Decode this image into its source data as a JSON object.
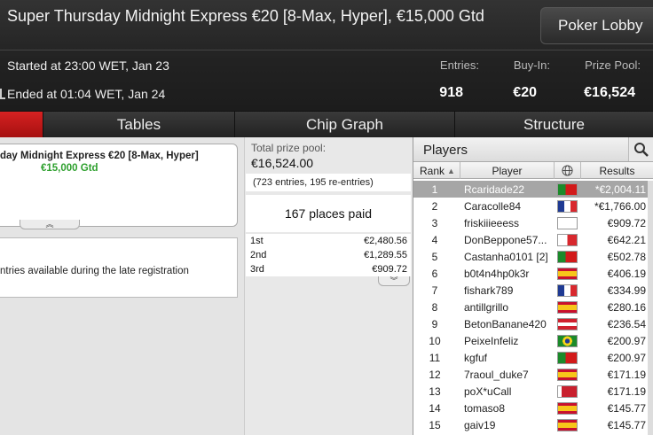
{
  "header": {
    "title": "Super Thursday Midnight Express €20 [8-Max, Hyper], €15,000 Gtd",
    "lobby_button": "Poker Lobby",
    "started": "Started at 23:00 WET, Jan 23",
    "ended": "Ended at 01:04 WET, Jan 24",
    "entries_label": "Entries:",
    "entries_value": "918",
    "buyin_label": "Buy-In:",
    "buyin_value": "€20",
    "prizepool_label": "Prize Pool:",
    "prizepool_value": "€16,524"
  },
  "tabs": [
    "Tables",
    "Chip Graph",
    "Structure"
  ],
  "left": {
    "name": "day Midnight Express €20 [8-Max, Hyper]",
    "gtd": "€15,000 Gtd",
    "late_text": "ntries available during the late registration",
    "expand_icon": "chevron-double-up"
  },
  "middle": {
    "pool_label": "Total prize pool:",
    "pool_value": "€16,524.00",
    "entries_note": "(723 entries, 195 re-entries)",
    "places_paid": "167 places paid",
    "payouts": [
      {
        "place": "1st",
        "value": "€2,480.56"
      },
      {
        "place": "2nd",
        "value": "€1,289.55"
      },
      {
        "place": "3rd",
        "value": "€909.72"
      }
    ],
    "expand_icon": "chevron-double-down"
  },
  "players": {
    "title": "Players",
    "columns": {
      "rank": "Rank",
      "player": "Player",
      "results": "Results"
    },
    "rows": [
      {
        "rank": "1",
        "player": "Rcaridade22",
        "result": "*€2,004.11",
        "flag": "portugal"
      },
      {
        "rank": "2",
        "player": "Caracolle84",
        "result": "*€1,766.00",
        "flag": "france"
      },
      {
        "rank": "3",
        "player": "friskiiieeess",
        "result": "€909.72",
        "flag": "denmark"
      },
      {
        "rank": "4",
        "player": "DonBeppone57...",
        "result": "€642.21",
        "flag": "italy"
      },
      {
        "rank": "5",
        "player": "Castanha0101 [2]",
        "result": "€502.78",
        "flag": "portugal"
      },
      {
        "rank": "6",
        "player": "b0t4n4hp0k3r",
        "result": "€406.19",
        "flag": "spain"
      },
      {
        "rank": "7",
        "player": "fishark789",
        "result": "€334.99",
        "flag": "france"
      },
      {
        "rank": "8",
        "player": "antillgrillo",
        "result": "€280.16",
        "flag": "spain"
      },
      {
        "rank": "9",
        "player": "BetonBanane420",
        "result": "€236.54",
        "flag": "austria"
      },
      {
        "rank": "10",
        "player": "PeixeInfeliz",
        "result": "€200.97",
        "flag": "brazil"
      },
      {
        "rank": "11",
        "player": "kgfuf",
        "result": "€200.97",
        "flag": "portugal"
      },
      {
        "rank": "12",
        "player": "7raoul_duke7",
        "result": "€171.19",
        "flag": "spain"
      },
      {
        "rank": "13",
        "player": "poX*uCall",
        "result": "€171.19",
        "flag": "belarus"
      },
      {
        "rank": "14",
        "player": "tomaso8",
        "result": "€145.77",
        "flag": "spain"
      },
      {
        "rank": "15",
        "player": "gaiv19",
        "result": "€145.77",
        "flag": "spain"
      }
    ]
  },
  "colors": {
    "accent_red": "#c41a1a",
    "gtd_green": "#2ea02e",
    "selected_row": "#a6a6a6"
  }
}
